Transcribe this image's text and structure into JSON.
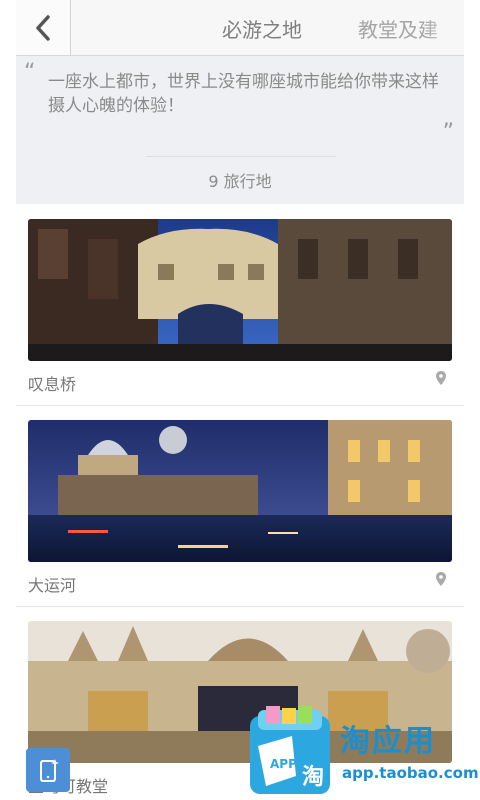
{
  "header": {
    "back_icon": "chevron-left-icon",
    "tabs": [
      {
        "label": "必游之地",
        "active": true
      },
      {
        "label": "教堂及建"
      }
    ]
  },
  "intro": {
    "quote": "一座水上都市，世界上没有哪座城市能给你带来这样摄人心魄的体验！",
    "open_mark": "“",
    "close_mark": "”",
    "count_label": "9 旅行地"
  },
  "places": [
    {
      "name": "叹息桥",
      "icon": "location-pin-icon"
    },
    {
      "name": "大运河",
      "icon": "location-pin-icon"
    },
    {
      "name": "圣马可教堂",
      "icon": "location-pin-icon"
    }
  ],
  "watermark": {
    "brand": "淘应用",
    "url": "app.taobao.com",
    "logo_text": "APP",
    "logo_char": "淘"
  },
  "colors": {
    "accent": "#1a8fd0",
    "float_button": "#4d8fd6"
  }
}
